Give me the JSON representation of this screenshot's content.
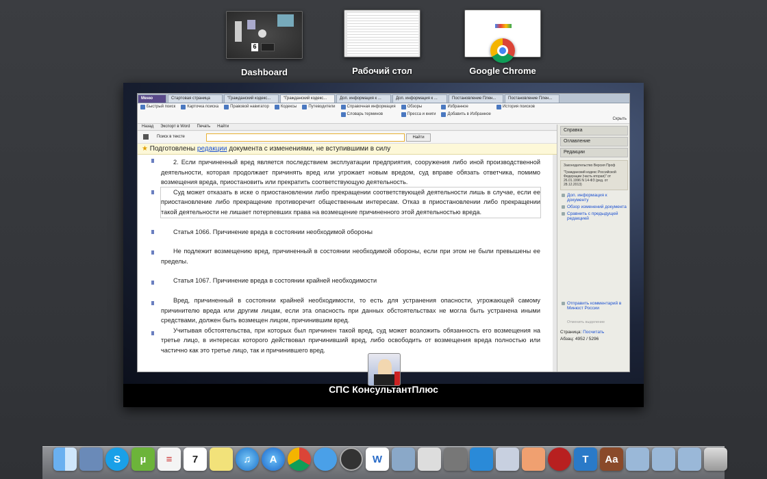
{
  "spaces": [
    {
      "id": "dashboard",
      "label": "Dashboard"
    },
    {
      "id": "desktop",
      "label": "Рабочий стол"
    },
    {
      "id": "chrome",
      "label": "Google Chrome"
    }
  ],
  "dashboard_thumb": {
    "calendar_day": "6"
  },
  "app_window": {
    "caption": "СПС КонсультантПлюс",
    "tabs": [
      "Меню",
      "Стартовая страница",
      "\"Гражданский кодекс...",
      "\"Гражданский кодекс...",
      "Доп. информация к ...",
      "Доп. информация к ...",
      "Постановление Плен...",
      "Постановление Плен..."
    ],
    "ribbon": {
      "col1": [
        "Быстрый поиск",
        "Карточка поиска",
        "Правовой навигатор",
        "Кодексы",
        "Путеводители"
      ],
      "col2": [
        "Справочная информация",
        "Словарь терминов"
      ],
      "col3": [
        "Обзоры",
        "Пресса и книги"
      ],
      "col4": [
        "Избранное",
        "Добавить в Избранное"
      ],
      "col5": [
        "История поисков"
      ],
      "hide": "Скрыть"
    },
    "toolbar": [
      "Назад",
      "Экспорт в Word",
      "Печать",
      "Найти"
    ],
    "search": {
      "label": "Поиск в тексте",
      "button": "Найти"
    },
    "notice": {
      "before": "Подготовлены ",
      "link": "редакции",
      "after": " документа с изменениями, не вступившими в силу"
    },
    "doc": {
      "p1": "2. Если причиненный вред является последствием эксплуатации предприятия, сооружения либо иной производственной деятельности, которая продолжает причинять вред или угрожает новым вредом, суд вправе обязать ответчика, помимо возмещения вреда, приостановить или прекратить соответствующую деятельность.",
      "p2": "Суд может отказать в иске о приостановлении либо прекращении соответствующей деятельности лишь в случае, если ее приостановление либо прекращение противоречит общественным интересам. Отказ в приостановлении либо прекращении такой деятельности не лишает потерпевших права на возмещение причиненного этой деятельностью вреда.",
      "art1066": "Статья 1066. Причинение вреда в состоянии необходимой обороны",
      "p3": "Не подлежит возмещению вред, причиненный в состоянии необходимой обороны, если при этом не были превышены ее пределы.",
      "art1067": "Статья 1067. Причинение вреда в состоянии крайней необходимости",
      "p4": "Вред, причиненный в состоянии крайней необходимости, то есть для устранения опасности, угрожающей самому причинителю вреда или другим лицам, если эта опасность при данных обстоятельствах не могла быть устранена иными средствами, должен быть возмещен лицом, причинившим вред.",
      "p5": "Учитывая обстоятельства, при которых был причинен такой вред, суд может возложить обязанность его возмещения на третье лицо, в интересах которого действовал причинивший вред, либо освободить от возмещения вреда полностью или частично как это третье лицо, так и причинившего вред."
    },
    "sidebar": {
      "buttons": [
        "Справка",
        "Оглавление",
        "Редакции"
      ],
      "box_title": "Законодательство Версия Проф",
      "box_text": "\"Гражданский кодекс Российской Федерации (часть вторая)\" от 26.01.1996 N 14-ФЗ (ред. от 28.12.2013)",
      "links": [
        "Доп. информация к документу",
        "Обзор изменений документа",
        "Сравнить с предыдущей редакцией"
      ],
      "comment_link": "Отправить комментарий в Минюст России",
      "cancel_selection": "Отменить выделение",
      "page_label": "Страница:",
      "page_action": "Посчитать",
      "para_label": "Абзац:",
      "para_value": "4952 / 5296"
    }
  },
  "dock": [
    "Finder",
    "Preview",
    "Skype",
    "uTorrent",
    "Reminders",
    "Calendar",
    "Stickies",
    "iTunes",
    "App Store",
    "Chrome",
    "Messages",
    "Photo Booth",
    "Word",
    "iPhoto",
    "Disk Utility",
    "Utility",
    "Windows",
    "Consultant",
    "Consultant2",
    "Doc",
    "Tool",
    "Dictionary",
    "Folder",
    "Downloads",
    "Documents",
    "Trash"
  ],
  "dock_calendar_day": "7"
}
